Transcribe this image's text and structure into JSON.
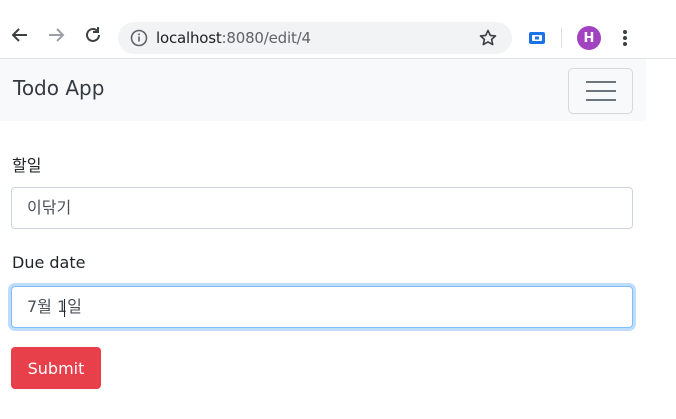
{
  "browser": {
    "url_host": "localhost",
    "url_path": ":8080/edit/4",
    "profile_initial": "H"
  },
  "navbar": {
    "brand": "Todo App"
  },
  "form": {
    "task_label": "할일",
    "task_value": "이닦기",
    "due_label": "Due date",
    "due_value_before_caret": "7월 1",
    "due_value_after_caret": "일",
    "submit_label": "Submit"
  },
  "colors": {
    "submit": "#e8404b",
    "focus_border": "#80bdff",
    "avatar": "#a142c0"
  }
}
